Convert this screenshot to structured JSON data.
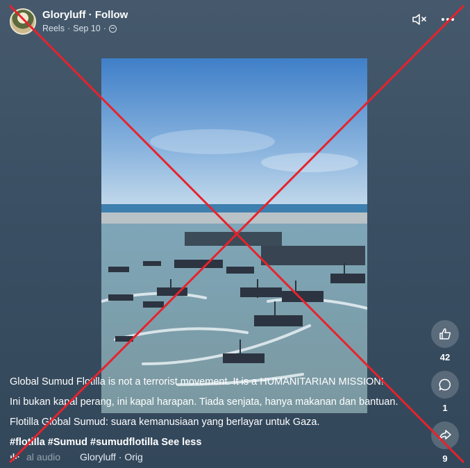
{
  "header": {
    "username": "Gloryluff",
    "separator": " · ",
    "follow_label": "Follow",
    "reels_label": "Reels",
    "date": "Sep 10",
    "dot": "·"
  },
  "top_icons": [
    "mute-icon",
    "more-icon"
  ],
  "actions": {
    "likes": "42",
    "comments": "1",
    "shares": "9"
  },
  "caption": {
    "line1": "Global Sumud Flotilla is not a terrorist movement. It is a HUMANITARIAN MISSION!",
    "line2": "Ini bukan kapal perang, ini kapal harapan. Tiada senjata, hanya makanan dan bantuan.",
    "line3": "Flotilla Global Sumud: suara kemanusiaan yang berlayar untuk Gaza.",
    "hashtags": "#flotilla #Sumud #sumudflotilla",
    "see_less": "See less"
  },
  "audio": {
    "text": "al audio",
    "owner": "Gloryluff · Orig"
  },
  "colors": {
    "background": "#3e5266",
    "cross": "#e8222b",
    "sky": "#7ea7cf",
    "sea": "#8fb3c2"
  }
}
